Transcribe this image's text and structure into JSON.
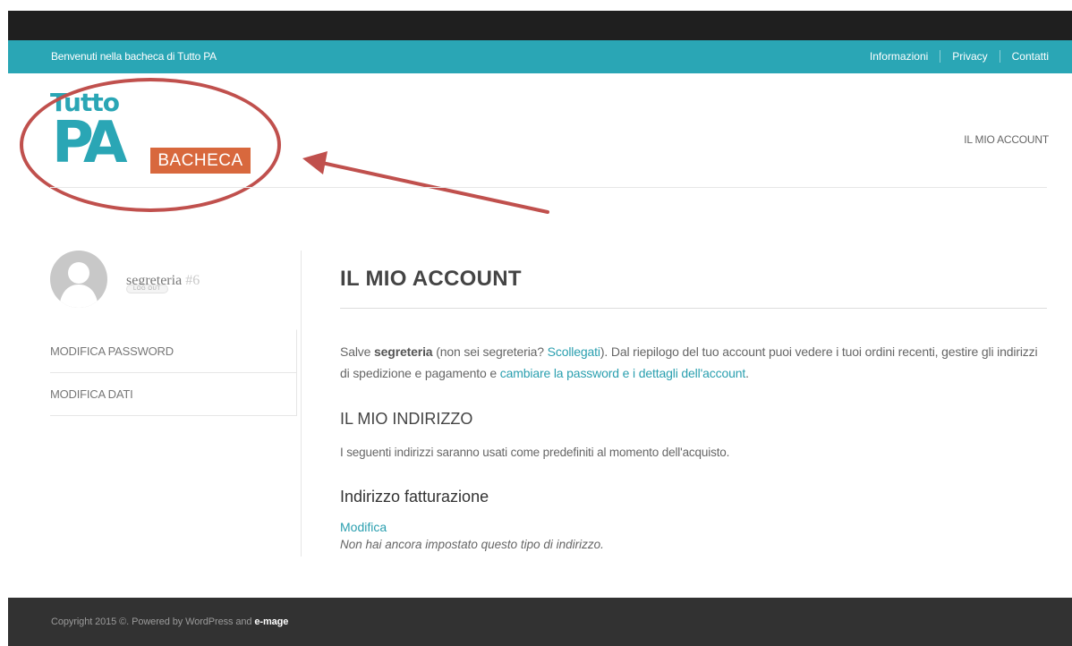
{
  "topbar": {
    "welcome": "Benvenuti nella bacheca di Tutto PA",
    "links": [
      "Informazioni",
      "Privacy",
      "Contatti"
    ]
  },
  "logo": {
    "line1": "Tutto",
    "line2": "PA",
    "tag": "BACHECA",
    "teal": "#2aa6b5",
    "orange": "#d8683d"
  },
  "header": {
    "account_link": "IL MIO ACCOUNT"
  },
  "sidebar": {
    "username": "segreteria",
    "user_id": "#6",
    "logout_label": "LOG OUT",
    "items": [
      "MODIFICA PASSWORD",
      "MODIFICA DATI"
    ]
  },
  "main": {
    "title": "IL MIO ACCOUNT",
    "intro": {
      "p1": "Salve ",
      "user": "segreteria",
      "p2": " (non sei segreteria? ",
      "logout_link": "Scollegati",
      "p3": "). Dal riepilogo del tuo account puoi vedere i tuoi ordini recenti, gestire gli indirizzi di spedizione e pagamento e ",
      "account_link": "cambiare la password e i dettagli dell'account",
      "p4": "."
    },
    "address_title": "IL MIO INDIRIZZO",
    "address_desc": "I seguenti indirizzi saranno usati come predefiniti al momento dell'acquisto.",
    "billing_title": "Indirizzo fatturazione",
    "edit_link": "Modifica",
    "no_address": "Non hai ancora impostato questo tipo di indirizzo."
  },
  "footer": {
    "copyright": "Copyright 2015 ©. Powered by WordPress and ",
    "brand": "e-mage"
  },
  "annotation": {
    "color": "#c0504d"
  }
}
